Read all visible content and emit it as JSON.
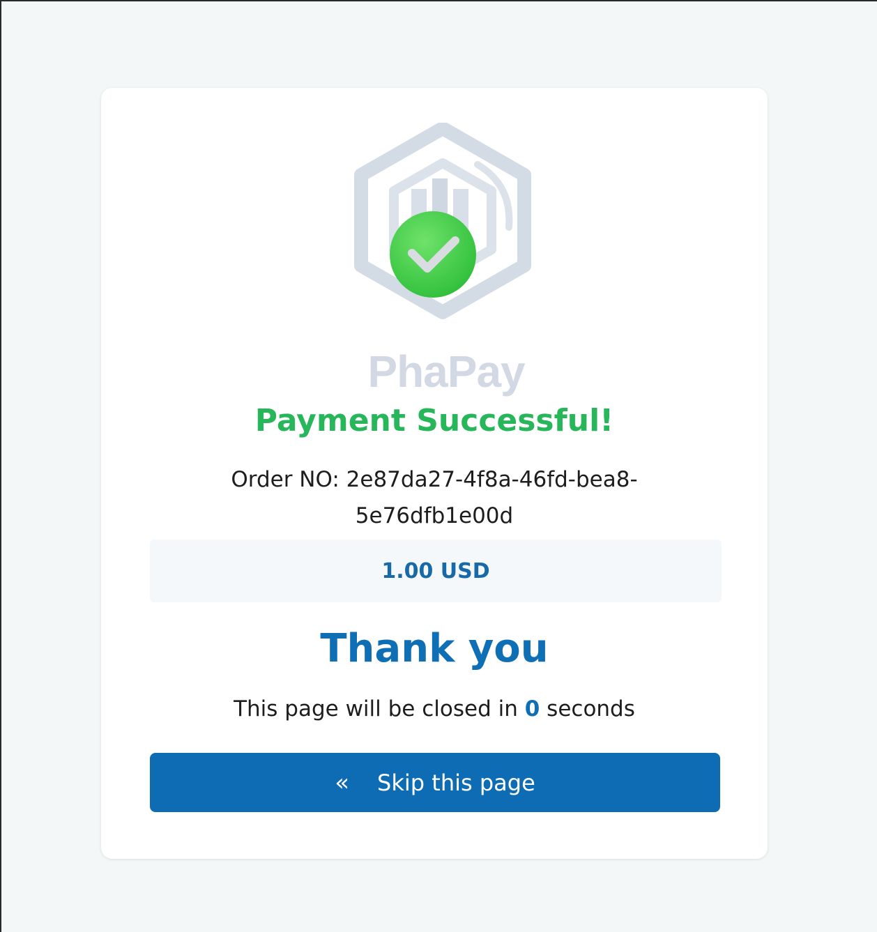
{
  "logo": {
    "brand_name": "PhaPay"
  },
  "status": {
    "title": "Payment Successful!",
    "order_label": "Order NO:",
    "order_number": "2e87da27-4f8a-46fd-bea8-5e76dfb1e00d"
  },
  "amount": {
    "value": "1.00 USD"
  },
  "thanks": {
    "heading": "Thank you",
    "countdown_prefix": "This page will be closed in",
    "countdown_value": "0",
    "countdown_suffix": "seconds"
  },
  "actions": {
    "skip_icon": "«",
    "skip_label": "Skip this page"
  },
  "colors": {
    "success_green": "#27b75a",
    "primary_blue": "#0e6cb4",
    "logo_gray": "#d0d8e3"
  },
  "icons": {
    "logo": "phapay-hexagon-logo-icon",
    "success": "check-circle-icon",
    "skip": "double-chevron-left-icon"
  }
}
